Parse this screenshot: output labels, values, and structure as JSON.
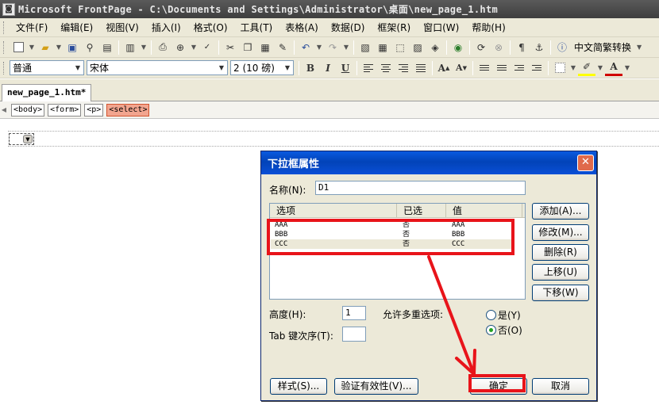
{
  "window": {
    "app_icon": "frontpage-app-icon",
    "title": "Microsoft FrontPage - C:\\Documents and Settings\\Administrator\\桌面\\new_page_1.htm"
  },
  "menubar": {
    "items": [
      "文件(F)",
      "编辑(E)",
      "视图(V)",
      "插入(I)",
      "格式(O)",
      "工具(T)",
      "表格(A)",
      "数据(D)",
      "框架(R)",
      "窗口(W)",
      "帮助(H)"
    ]
  },
  "toolbar_standard": {
    "icons": [
      "new-page-icon",
      "open-icon",
      "save-icon",
      "search-icon",
      "publish-icon",
      "folder-list-icon",
      "print-icon",
      "preview-icon",
      "spelling-icon",
      "cut-icon",
      "copy-icon",
      "paste-icon",
      "format-painter-icon",
      "undo-icon",
      "redo-icon",
      "web-component-icon",
      "insert-table-icon",
      "layer-icon",
      "picture-icon",
      "drawing-icon",
      "hyperlink-icon",
      "refresh-icon",
      "stop-icon",
      "show-all-icon",
      "bookmark-icon",
      "help-icon"
    ],
    "convert_label": "中文简繁转换"
  },
  "toolbar_format": {
    "style_value": "普通",
    "font_value": "宋体",
    "size_value": "2 (10 磅)",
    "bold": "B",
    "italic": "I",
    "underline": "U",
    "grow_font": "A",
    "shrink_font": "A",
    "font_color": "A"
  },
  "document": {
    "tab_label": "new_page_1.htm*",
    "tags": [
      "<body>",
      "<form>",
      "<p>",
      "<select>"
    ],
    "active_tag_index": 3
  },
  "dialog": {
    "title": "下拉框属性",
    "name_label": "名称(N):",
    "name_value": "D1",
    "columns": [
      "选项",
      "已选",
      "值"
    ],
    "rows": [
      {
        "option": "AAA",
        "selected": "否",
        "value": "AAA"
      },
      {
        "option": "BBB",
        "selected": "否",
        "value": "BBB"
      },
      {
        "option": "CCC",
        "selected": "否",
        "value": "CCC"
      }
    ],
    "buttons_side": [
      "添加(A)...",
      "修改(M)...",
      "删除(R)",
      "上移(U)",
      "下移(W)"
    ],
    "height_label": "高度(H):",
    "height_value": "1",
    "multi_label": "允许多重选项:",
    "radio_yes": "是(Y)",
    "radio_no": "否(O)",
    "multi_selected": "否(O)",
    "tab_order_label": "Tab 键次序(T):",
    "tab_order_value": "",
    "style_button": "样式(S)...",
    "validate_button": "验证有效性(V)...",
    "ok_button": "确定",
    "cancel_button": "取消"
  },
  "annotations": {
    "highlight_color": "#e8141a"
  }
}
